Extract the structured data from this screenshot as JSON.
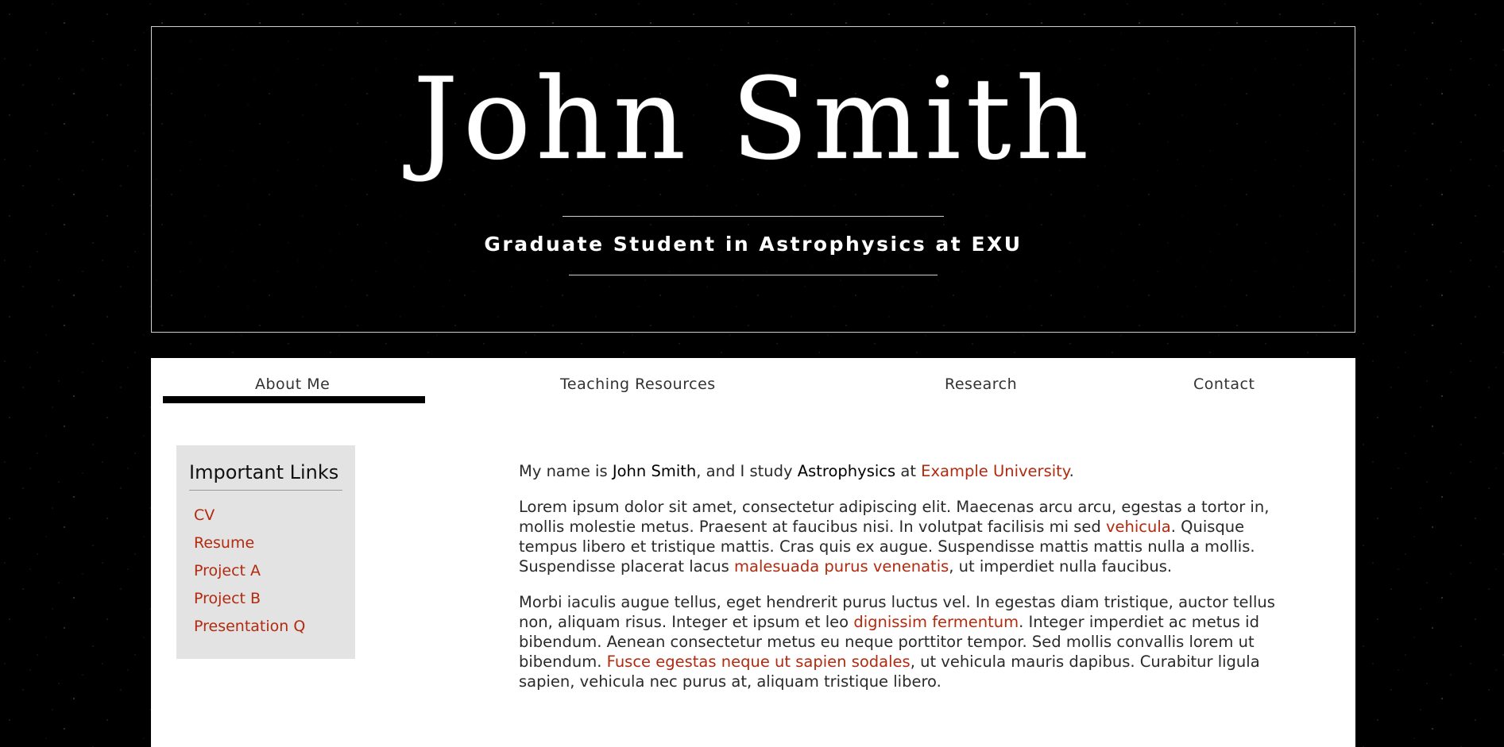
{
  "header": {
    "title": "John Smith",
    "subtitle": "Graduate Student in Astrophysics at EXU"
  },
  "nav": {
    "items": [
      {
        "label": "About Me",
        "active": true
      },
      {
        "label": "Teaching Resources",
        "active": false
      },
      {
        "label": "Research",
        "active": false
      },
      {
        "label": "Contact",
        "active": false
      }
    ]
  },
  "sidebar": {
    "title": "Important Links",
    "links": [
      "CV",
      "Resume",
      "Project A",
      "Project B",
      "Presentation Q"
    ]
  },
  "main": {
    "intro": {
      "t1": "My name is ",
      "name": "John Smith",
      "t2": ", and I study ",
      "field": "Astrophysics",
      "t3": " at ",
      "university": "Example University",
      "t4": "."
    },
    "para1": {
      "t1": "Lorem ipsum dolor sit amet, consectetur adipiscing elit. Maecenas arcu arcu, egestas a tortor in, mollis molestie metus. Praesent at faucibus nisi. In volutpat facilisis mi sed ",
      "link1": "vehicula",
      "t2": ". Quisque tempus libero et tristique mattis. Cras quis ex augue. Suspendisse mattis mattis nulla a mollis. Suspendisse placerat lacus ",
      "link2": "malesuada purus venenatis",
      "t3": ", ut imperdiet nulla faucibus."
    },
    "para2": {
      "t1": "Morbi iaculis augue tellus, eget hendrerit purus luctus vel. In egestas diam tristique, auctor tellus non, aliquam risus. Integer et ipsum et leo ",
      "link1": "dignissim fermentum",
      "t2": ". Integer imperdiet ac metus id bibendum. Aenean consectetur metus eu neque porttitor tempor. Sed mollis convallis lorem ut bibendum. ",
      "link2": "Fusce egestas neque ut sapien sodales",
      "t3": ", ut vehicula mauris dapibus. Curabitur ligula sapien, vehicula nec purus at, aliquam tristique libero."
    }
  },
  "colors": {
    "link": "#b22a0f",
    "background": "#000000",
    "content_bg": "#ffffff",
    "sidebar_bg": "#e3e3e3"
  }
}
